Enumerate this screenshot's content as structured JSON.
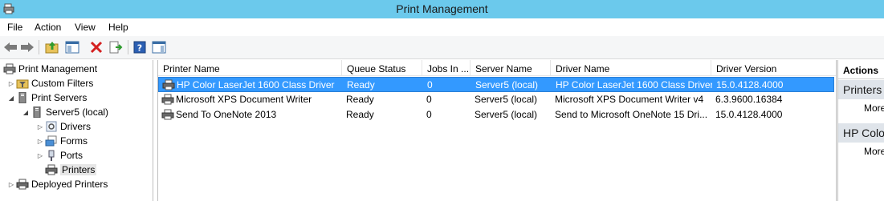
{
  "window": {
    "title": "Print Management"
  },
  "menu": [
    "File",
    "Action",
    "View",
    "Help"
  ],
  "toolbar": {
    "buttons": [
      "back-arrow-icon",
      "forward-arrow-icon",
      "up-folder-icon",
      "show-hide-tree-icon",
      "delete-icon",
      "export-list-icon",
      "help-icon",
      "show-hide-action-pane-icon"
    ]
  },
  "tree": {
    "root": "Print Management",
    "custom_filters": "Custom Filters",
    "print_servers": "Print Servers",
    "server": "Server5 (local)",
    "drivers": "Drivers",
    "forms": "Forms",
    "ports": "Ports",
    "printers": "Printers",
    "deployed_printers": "Deployed Printers"
  },
  "list": {
    "columns": [
      "Printer Name",
      "Queue Status",
      "Jobs In ...",
      "Server Name",
      "Driver Name",
      "Driver Version"
    ],
    "rows": [
      {
        "printer_name": "HP Color LaserJet 1600 Class Driver",
        "queue_status": "Ready",
        "jobs": "0",
        "server_name": "Server5 (local)",
        "driver_name": "HP Color LaserJet 1600 Class Driver",
        "driver_version": "15.0.4128.4000"
      },
      {
        "printer_name": "Microsoft XPS Document Writer",
        "queue_status": "Ready",
        "jobs": "0",
        "server_name": "Server5 (local)",
        "driver_name": "Microsoft XPS Document Writer v4",
        "driver_version": "6.3.9600.16384"
      },
      {
        "printer_name": "Send To OneNote 2013",
        "queue_status": "Ready",
        "jobs": "0",
        "server_name": "Server5 (local)",
        "driver_name": "Send to Microsoft OneNote 15 Dri...",
        "driver_version": "15.0.4128.4000"
      }
    ]
  },
  "actions": {
    "header": "Actions",
    "section1": "Printers",
    "section1_more": "More",
    "section2": "HP Colo",
    "section2_more": "More"
  },
  "colors": {
    "titlebar": "#6bc9ec",
    "selection": "#3399ff"
  }
}
